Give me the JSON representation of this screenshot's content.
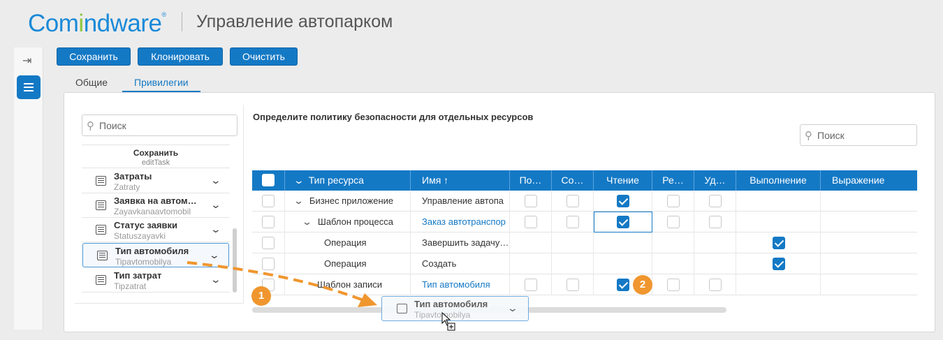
{
  "header": {
    "logo_a": "Com",
    "logo_b": "i",
    "logo_c": "ndware",
    "logo_mark": "®",
    "title": "Управление автопарком"
  },
  "toolbar": {
    "save": "Сохранить",
    "clone": "Клонировать",
    "clear": "Очистить"
  },
  "tabs": [
    {
      "label": "Общие",
      "active": false
    },
    {
      "label": "Привилегии",
      "active": true
    }
  ],
  "left": {
    "search_placeholder": "Поиск",
    "top_item": {
      "title": "Сохранить",
      "sub": "editTask"
    },
    "items": [
      {
        "title": "Затраты",
        "sub": "Zatraty"
      },
      {
        "title": "Заявка на автом…",
        "sub": "Zayavkanaavtomobil"
      },
      {
        "title": "Статус заявки",
        "sub": "Statuszayavki"
      },
      {
        "title": "Тип автомобиля",
        "sub": "Tipavtomobilya",
        "selected": true
      },
      {
        "title": "Тип затрат",
        "sub": "Tipzatrat"
      }
    ]
  },
  "right": {
    "title": "Определите политику безопасности для отдельных ресурсов",
    "search_placeholder": "Поиск"
  },
  "grid": {
    "columns": [
      "Тип ресурса",
      "Имя ↑",
      "По…",
      "Со…",
      "Чтение",
      "Ре…",
      "Уд…",
      "Выполнение",
      "Выражение"
    ],
    "rows": [
      {
        "type": "Бизнес приложение",
        "name": "Управление автопа",
        "link": false,
        "level": 1,
        "expand": true,
        "perm": [
          false,
          false,
          true,
          false,
          false
        ],
        "exec": null
      },
      {
        "type": "Шаблон процесса",
        "name": "Заказ автотранспор",
        "link": true,
        "level": 2,
        "expand": true,
        "perm": [
          false,
          false,
          true,
          false,
          false
        ],
        "exec": null
      },
      {
        "type": "Операция",
        "name": "Завершить задачу…",
        "link": false,
        "level": 3,
        "expand": false,
        "perm": null,
        "exec": true
      },
      {
        "type": "Операция",
        "name": "Создать",
        "link": false,
        "level": 3,
        "expand": false,
        "perm": null,
        "exec": true
      },
      {
        "type": "Шаблон записи",
        "name": "Тип автомобиля",
        "link": true,
        "level": 2,
        "expand": false,
        "perm": [
          false,
          false,
          true,
          false,
          false
        ],
        "exec": null
      }
    ]
  },
  "drag": {
    "title": "Тип автомобиля",
    "sub": "Tipavtomobilya"
  },
  "badges": {
    "step1": "1",
    "step2": "2"
  },
  "colors": {
    "accent": "#1479c5",
    "logo_green": "#8ec63f",
    "badge": "#f0962e"
  }
}
